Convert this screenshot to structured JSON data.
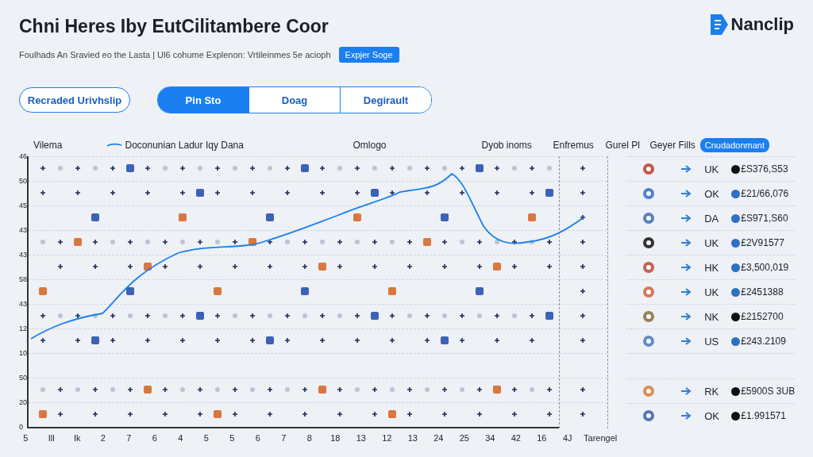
{
  "header": {
    "title": "Chni Heres Iby EutCilitambere Coor",
    "subtitle": "Foulhads An Sravied eo the Lasta | Ul6 cohume Explenon: Vrtileinmes 5e acioph",
    "action_button": "Expjer Soge"
  },
  "logo": {
    "text": "Nanclip"
  },
  "filter_pill": {
    "label": "Recraded Urivhslip"
  },
  "segments": [
    {
      "label": "Pin Sto",
      "selected": true
    },
    {
      "label": "Doag",
      "selected": false
    },
    {
      "label": "Degirault",
      "selected": false
    }
  ],
  "chart": {
    "axis_title": "Vilema",
    "legend": "Doconunian Ladur Iqy Dana",
    "column_labels": [
      "Omlogo",
      "Dyob inoms"
    ],
    "y_labels": [
      "46",
      "50",
      "45",
      "43",
      "43",
      "58",
      "43",
      "12",
      "10",
      "50",
      "20",
      "0"
    ],
    "x_labels": [
      "5",
      "Ill",
      "Ik",
      "2",
      "7",
      "6",
      "4",
      "5",
      "5",
      "6",
      "7",
      "8",
      "18",
      "13",
      "12",
      "13",
      "24",
      "25",
      "34",
      "42",
      "16",
      "4J"
    ],
    "side_column": {
      "label": "Enfremus",
      "x_label": "Tarengel"
    }
  },
  "table": {
    "columns": [
      "Gurel Pl",
      "Geyer Fills"
    ],
    "badge": "Cnudadonmant",
    "row_groups": [
      [
        {
          "code": "UK",
          "amount": "£S376,S53",
          "color": "#111111"
        },
        {
          "code": "OK",
          "amount": "£21/66,076",
          "color": "#2f6fc4"
        },
        {
          "code": "DA",
          "amount": "£S971,S60",
          "color": "#2f6fc4"
        },
        {
          "code": "UK",
          "amount": "£2V91577",
          "color": "#2f6fc4"
        },
        {
          "code": "HK",
          "amount": "£3,500,019",
          "color": "#2f6fc4"
        },
        {
          "code": "UK",
          "amount": "£2451388",
          "color": "#2f6fc4"
        },
        {
          "code": "NK",
          "amount": "£2152700",
          "color": "#111111"
        },
        {
          "code": "US",
          "amount": "£243.2109",
          "color": "#2f6fc4"
        }
      ],
      [
        {
          "code": "RK",
          "amount": "£5900S 3UB",
          "color": "#111111"
        },
        {
          "code": "OK",
          "amount": "£1.991571",
          "color": "#111111"
        }
      ]
    ]
  }
}
